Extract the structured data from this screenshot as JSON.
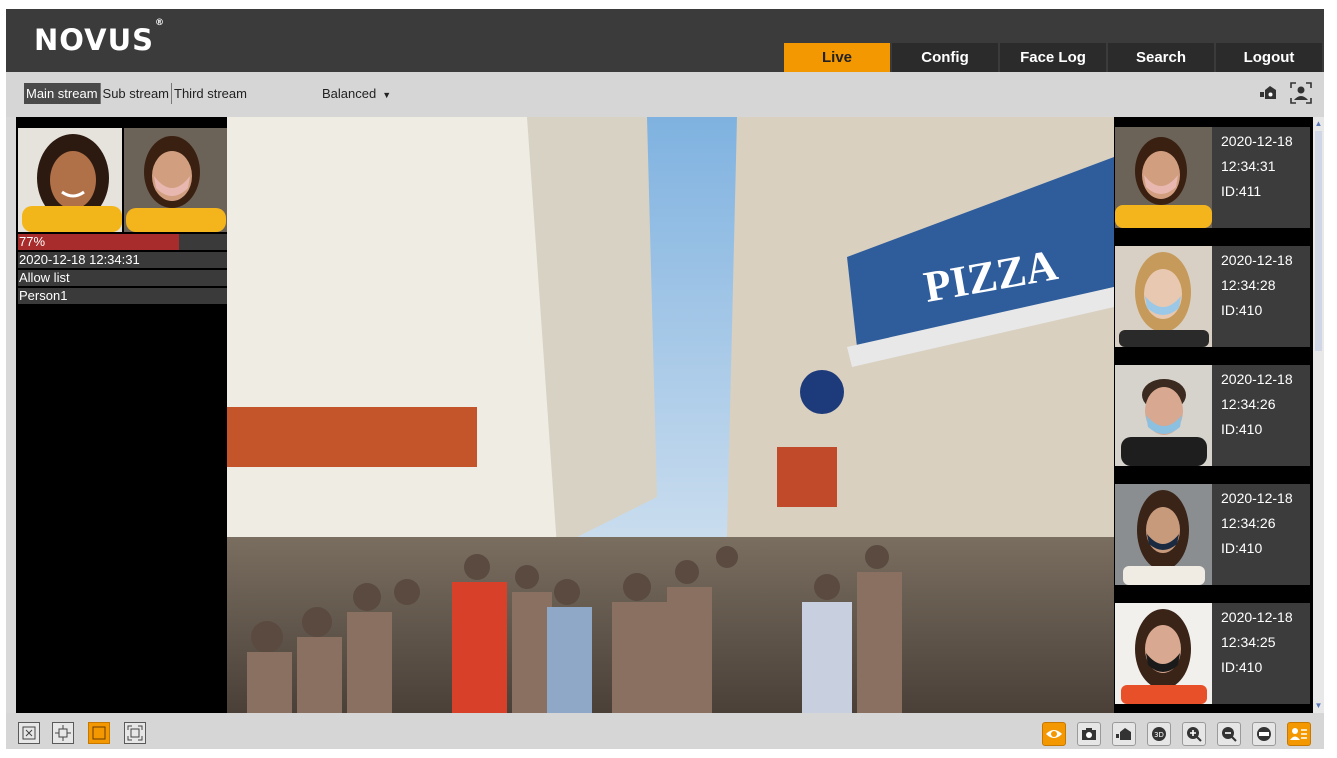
{
  "brand": {
    "logo_text": "NOVUS",
    "logo_mark": "®"
  },
  "nav": {
    "tabs": [
      {
        "label": "Live",
        "active": true
      },
      {
        "label": "Config",
        "active": false
      },
      {
        "label": "Face Log",
        "active": false
      },
      {
        "label": "Search",
        "active": false
      },
      {
        "label": "Logout",
        "active": false
      }
    ]
  },
  "streams": [
    {
      "label": "Main stream",
      "active": true
    },
    {
      "label": "Sub stream",
      "active": false
    },
    {
      "label": "Third stream",
      "active": false
    }
  ],
  "quality": {
    "selected": "Balanced"
  },
  "top_icons": [
    "record-icon",
    "face-person-icon"
  ],
  "match": {
    "confidence_label": "77%",
    "confidence": 0.77,
    "timestamp": "2020-12-18 12:34:31",
    "list": "Allow list",
    "person": "Person1"
  },
  "captures": [
    {
      "date": "2020-12-18",
      "time": "12:34:31",
      "id": "ID:411"
    },
    {
      "date": "2020-12-18",
      "time": "12:34:28",
      "id": "ID:410"
    },
    {
      "date": "2020-12-18",
      "time": "12:34:26",
      "id": "ID:410"
    },
    {
      "date": "2020-12-18",
      "time": "12:34:26",
      "id": "ID:410"
    },
    {
      "date": "2020-12-18",
      "time": "12:34:25",
      "id": "ID:410"
    }
  ],
  "bottom_left_icons": [
    "original-size-icon",
    "fit-window-icon",
    "stretch-icon",
    "fullscreen-icon"
  ],
  "bottom_right_icons": [
    "live-view-icon",
    "snapshot-icon",
    "record-icon",
    "3d-zoom-icon",
    "zoom-in-icon",
    "zoom-out-icon",
    "audio-icon",
    "face-panel-icon"
  ],
  "colors": {
    "accent": "#f39800",
    "topbar": "#3b3b3b",
    "confidence_bar": "#a92c2c"
  }
}
